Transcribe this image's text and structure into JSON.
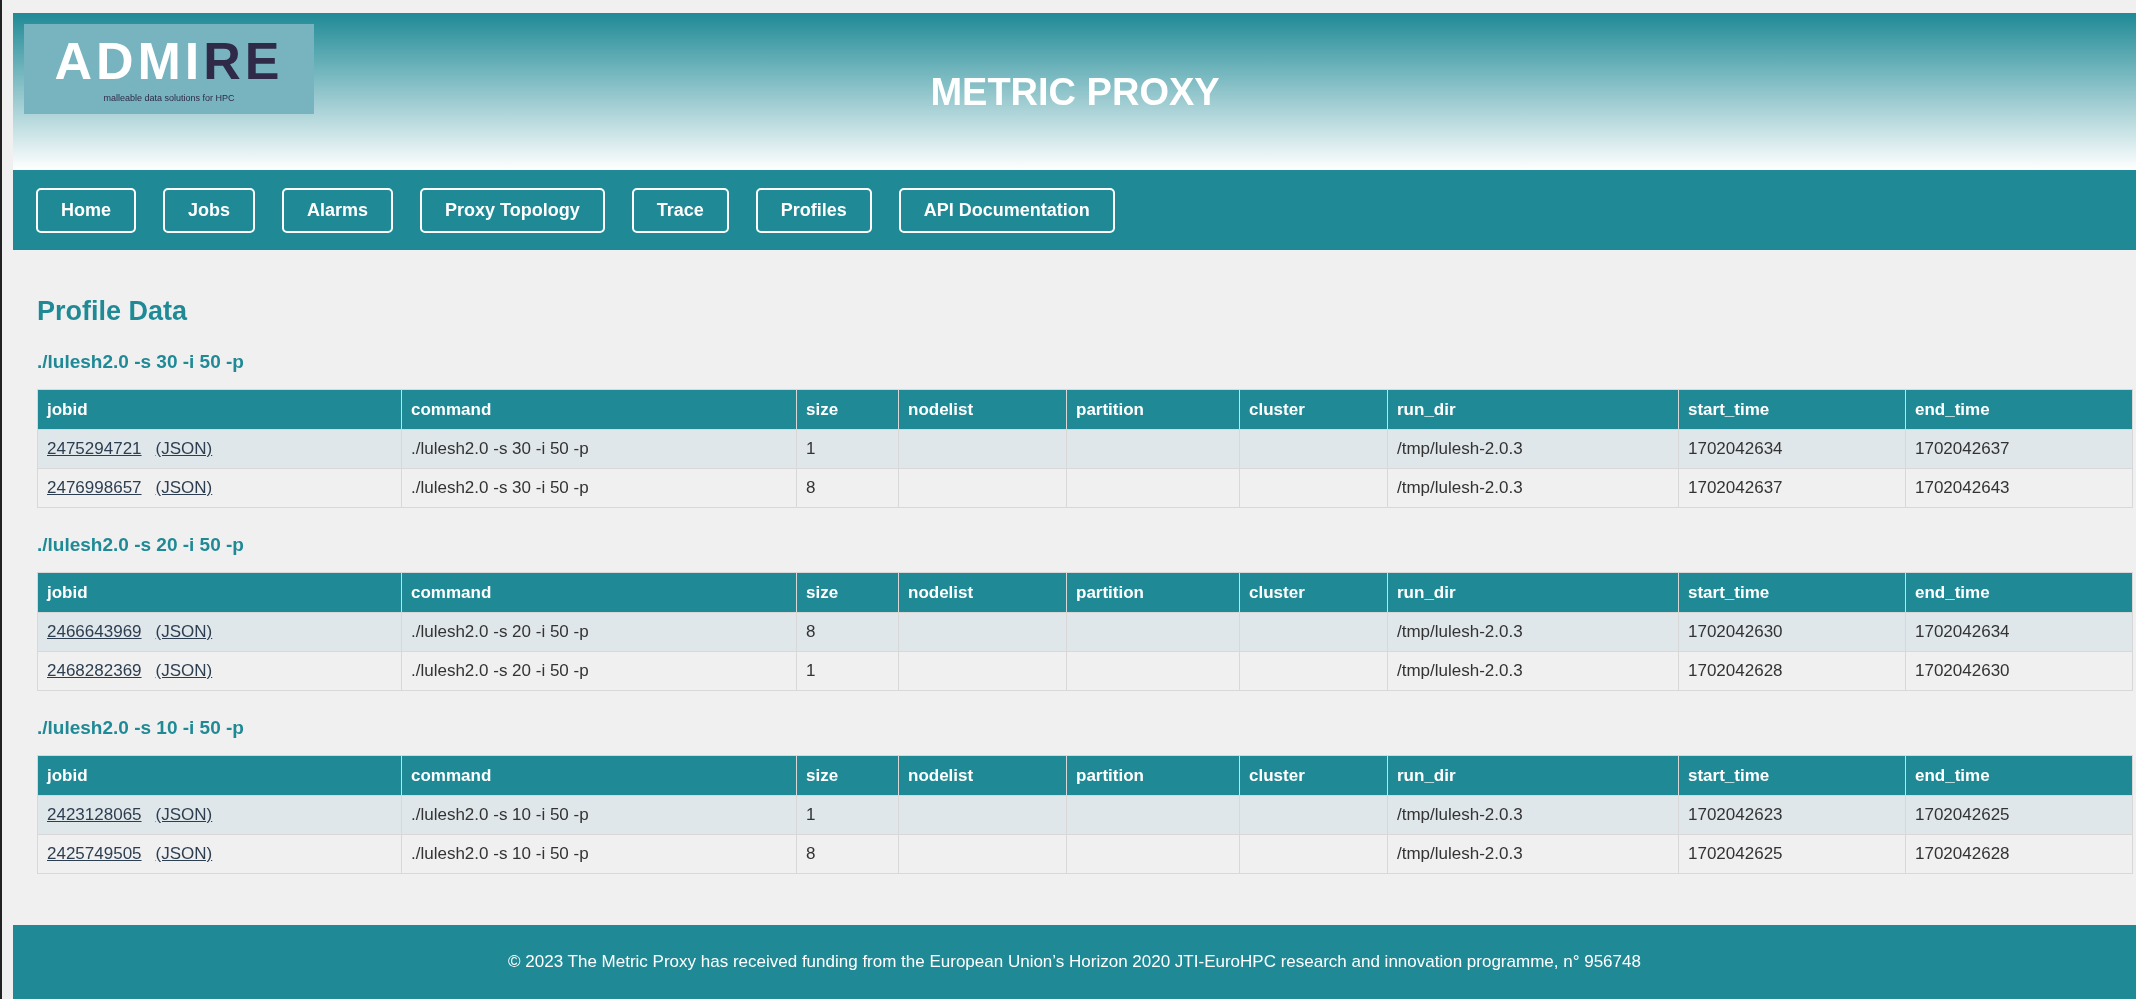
{
  "header": {
    "logo": {
      "wordmark_light": "ADMI",
      "wordmark_dark": "RE",
      "tagline": "malleable data solutions for HPC"
    },
    "title": "METRIC PROXY"
  },
  "nav": [
    "Home",
    "Jobs",
    "Alarms",
    "Proxy Topology",
    "Trace",
    "Profiles",
    "API Documentation"
  ],
  "page_title": "Profile Data",
  "groups": [
    {
      "heading": "./lulesh2.0 -s 30 -i 50 -p",
      "columns": [
        "jobid",
        "command",
        "size",
        "nodelist",
        "partition",
        "cluster",
        "run_dir",
        "start_time",
        "end_time"
      ],
      "rows": [
        {
          "jobid": "2475294721",
          "json": "(JSON)",
          "command": "./lulesh2.0 -s 30 -i 50 -p",
          "size": "1",
          "run_dir": "/tmp/lulesh-2.0.3",
          "start_time": "1702042634",
          "end_time": "1702042637"
        },
        {
          "jobid": "2476998657",
          "json": "(JSON)",
          "command": "./lulesh2.0 -s 30 -i 50 -p",
          "size": "8",
          "run_dir": "/tmp/lulesh-2.0.3",
          "start_time": "1702042637",
          "end_time": "1702042643"
        }
      ]
    },
    {
      "heading": "./lulesh2.0 -s 20 -i 50 -p",
      "columns": [
        "jobid",
        "command",
        "size",
        "nodelist",
        "partition",
        "cluster",
        "run_dir",
        "start_time",
        "end_time"
      ],
      "rows": [
        {
          "jobid": "2466643969",
          "json": "(JSON)",
          "command": "./lulesh2.0 -s 20 -i 50 -p",
          "size": "8",
          "run_dir": "/tmp/lulesh-2.0.3",
          "start_time": "1702042630",
          "end_time": "1702042634"
        },
        {
          "jobid": "2468282369",
          "json": "(JSON)",
          "command": "./lulesh2.0 -s 20 -i 50 -p",
          "size": "1",
          "run_dir": "/tmp/lulesh-2.0.3",
          "start_time": "1702042628",
          "end_time": "1702042630"
        }
      ]
    },
    {
      "heading": "./lulesh2.0 -s 10 -i 50 -p",
      "columns": [
        "jobid",
        "command",
        "size",
        "nodelist",
        "partition",
        "cluster",
        "run_dir",
        "start_time",
        "end_time"
      ],
      "rows": [
        {
          "jobid": "2423128065",
          "json": "(JSON)",
          "command": "./lulesh2.0 -s 10 -i 50 -p",
          "size": "1",
          "run_dir": "/tmp/lulesh-2.0.3",
          "start_time": "1702042623",
          "end_time": "1702042625"
        },
        {
          "jobid": "2425749505",
          "json": "(JSON)",
          "command": "./lulesh2.0 -s 10 -i 50 -p",
          "size": "8",
          "run_dir": "/tmp/lulesh-2.0.3",
          "start_time": "1702042625",
          "end_time": "1702042628"
        }
      ]
    }
  ],
  "footer": "© 2023 The Metric Proxy has received funding from the European Union’s Horizon 2020 JTI-EuroHPC research and innovation programme, n° 956748"
}
